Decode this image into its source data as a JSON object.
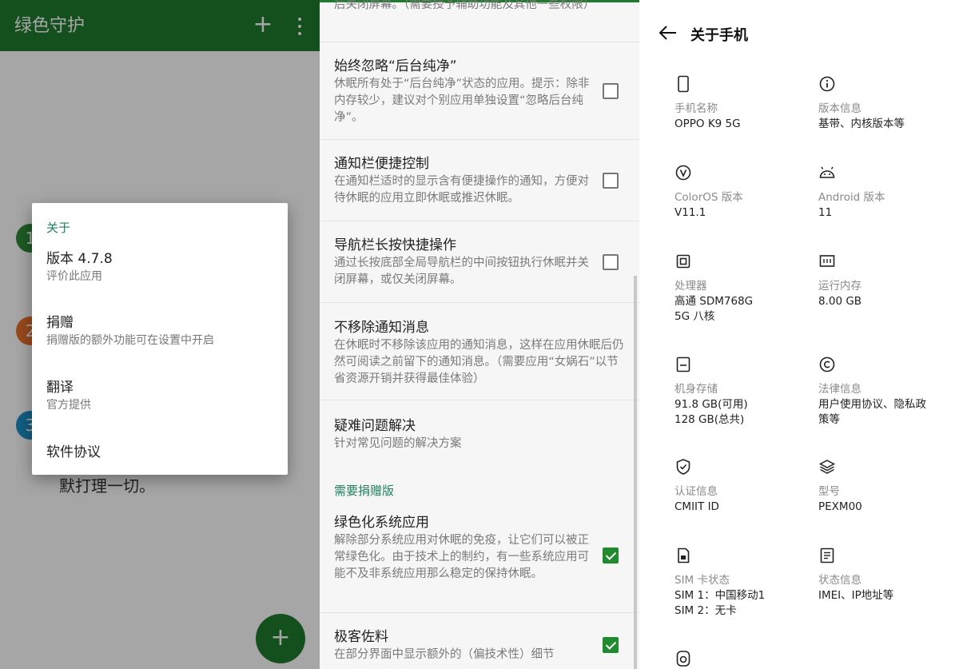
{
  "panel1": {
    "app_title": "绿色守护",
    "steps": [
      "1",
      "2",
      "3"
    ],
    "background_text": "默打理一切。",
    "fab_label": "+",
    "dialog": {
      "header": "关于",
      "items": [
        {
          "title": "版本 4.7.8",
          "subtitle": "评价此应用"
        },
        {
          "title": "捐赠",
          "subtitle": "捐赠版的额外功能可在设置中开启"
        },
        {
          "title": "翻译",
          "subtitle": "官方提供"
        },
        {
          "title": "软件协议",
          "subtitle": ""
        }
      ]
    },
    "colors": {
      "primary": "#1f7a2e",
      "accent": "#1f8060"
    }
  },
  "panel2": {
    "top_partial_desc": "后关闭屏幕。（需要授予辅助功能及其他一些权限）",
    "settings": [
      {
        "title": "始终忽略“后台纯净”",
        "desc": "休眠所有处于“后台纯净”状态的应用。提示：除非内存较少，建议对个别应用单独设置“忽略后台纯净”。",
        "checked": false
      },
      {
        "title": "通知栏便捷控制",
        "desc": "在通知栏适时的显示含有便捷操作的通知，方便对待休眠的应用立即休眠或推迟休眠。",
        "checked": false
      },
      {
        "title": "导航栏长按快捷操作",
        "desc": "通过长按底部全局导航栏的中间按钮执行休眠并关闭屏幕，或仅关闭屏幕。",
        "checked": false
      },
      {
        "title": "不移除通知消息",
        "desc": "在休眠时不移除该应用的通知消息，这样在应用休眠后仍然可阅读之前留下的通知消息。（需要应用“女娲石”以节省资源开销并获得最佳体验）"
      },
      {
        "title": "疑难问题解决",
        "desc": "针对常见问题的解决方案"
      }
    ],
    "donate_section": "需要捐赠版",
    "donate_settings": [
      {
        "title": "绿色化系统应用",
        "desc": "解除部分系统应用对休眠的免疫，让它们可以被正常绿色化。由于技术上的制约，有一些系统应用可能不及非系统应用那么稳定的保持休眠。",
        "checked": true
      },
      {
        "title": "极客佐料",
        "desc": "在部分界面中显示额外的（偏技术性）细节",
        "checked": true
      }
    ]
  },
  "panel3": {
    "title": "关于手机",
    "cells": [
      {
        "icon": "phone-icon",
        "label": "手机名称",
        "value": "OPPO K9 5G"
      },
      {
        "icon": "info-icon",
        "label": "版本信息",
        "value": "基带、内核版本等"
      },
      {
        "icon": "coloros-icon",
        "label": "ColorOS 版本",
        "value": "V11.1"
      },
      {
        "icon": "android-icon",
        "label": "Android 版本",
        "value": "11"
      },
      {
        "icon": "cpu-icon",
        "label": "处理器",
        "value": "高通 SDM768G 5G 八核"
      },
      {
        "icon": "memory-icon",
        "label": "运行内存",
        "value": "8.00 GB"
      },
      {
        "icon": "storage-icon",
        "label": "机身存储",
        "value": "91.8 GB(可用)\n128 GB(总共)"
      },
      {
        "icon": "copyright-icon",
        "label": "法律信息",
        "value": "用户使用协议、隐私政策等"
      },
      {
        "icon": "shield-check-icon",
        "label": "认证信息",
        "value": "CMIIT ID"
      },
      {
        "icon": "layers-icon",
        "label": "型号",
        "value": "PEXM00"
      },
      {
        "icon": "sim-card-icon",
        "label": "SIM 卡状态",
        "value": "SIM 1：中国移动1\nSIM 2：无卡"
      },
      {
        "icon": "document-icon",
        "label": "状态信息",
        "value": "IMEI、IP地址等"
      }
    ]
  }
}
